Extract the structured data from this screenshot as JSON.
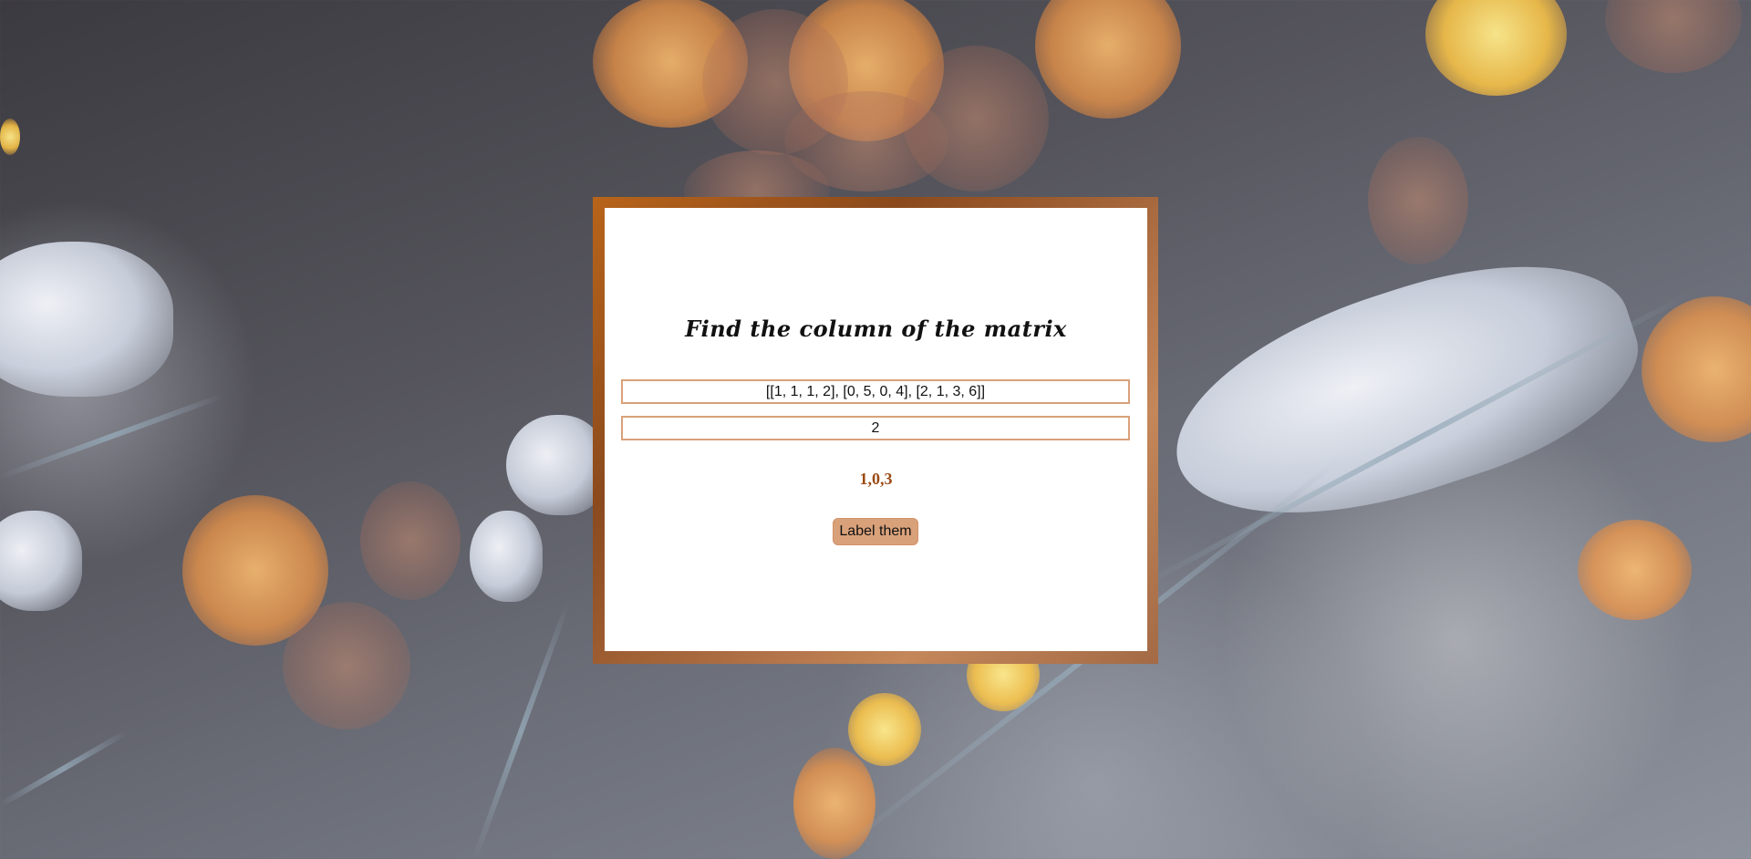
{
  "page": {
    "title": "Find the column of the matrix"
  },
  "form": {
    "matrix_value": "[[1, 1, 1, 2], [0, 5, 0, 4], [2, 1, 3, 6]]",
    "column_value": "2",
    "result": "1,0,3",
    "button_label": "Label them"
  },
  "colors": {
    "frame": "#8b4a1d",
    "button": "#d9a17a",
    "result_text": "#9a4a14",
    "field_border": "#d9a17a"
  },
  "background": {
    "description_icon": "snowy-pine-bokeh-background"
  }
}
